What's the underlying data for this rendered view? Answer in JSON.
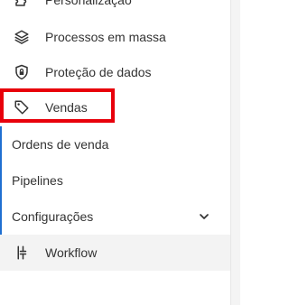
{
  "menu": {
    "items": [
      {
        "label": "Personalização",
        "icon": "puzzle-icon"
      },
      {
        "label": "Processos em massa",
        "icon": "layers-icon"
      },
      {
        "label": "Proteção de dados",
        "icon": "shield-lock-icon"
      },
      {
        "label": "Vendas",
        "icon": "tag-icon"
      }
    ],
    "vendas_submenu": {
      "items": [
        {
          "label": "Ordens de venda"
        },
        {
          "label": "Pipelines"
        },
        {
          "label": "Configurações",
          "icon": "chevron-down-icon"
        }
      ]
    },
    "workflow": {
      "label": "Workflow",
      "icon": "workflow-icon"
    }
  },
  "colors": {
    "highlight_border": "#e8000b",
    "active_accent": "#1f6fd1",
    "text": "#333333",
    "workflow_bg": "#f3f3f3"
  }
}
